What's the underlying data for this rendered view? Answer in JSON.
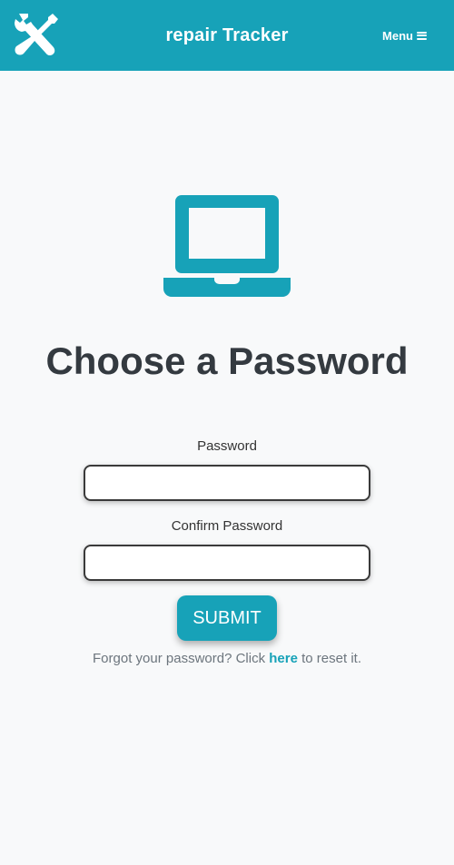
{
  "header": {
    "app_title": "repair Tracker",
    "menu_label": "Menu",
    "logo_icon": "tools-icon",
    "menu_icon": "hamburger-icon"
  },
  "main": {
    "hero_icon": "laptop-icon",
    "title": "Choose a Password",
    "password_label": "Password",
    "password_value": "",
    "confirm_label": "Confirm Password",
    "confirm_value": "",
    "submit_label": "SUBMIT",
    "forgot_prefix": "Forgot your password? Click ",
    "forgot_link": "here",
    "forgot_suffix": " to reset it."
  },
  "colors": {
    "accent": "#17a2b8",
    "title_text": "#343a40",
    "muted_text": "#6c757d",
    "background": "#f8f9fa"
  }
}
